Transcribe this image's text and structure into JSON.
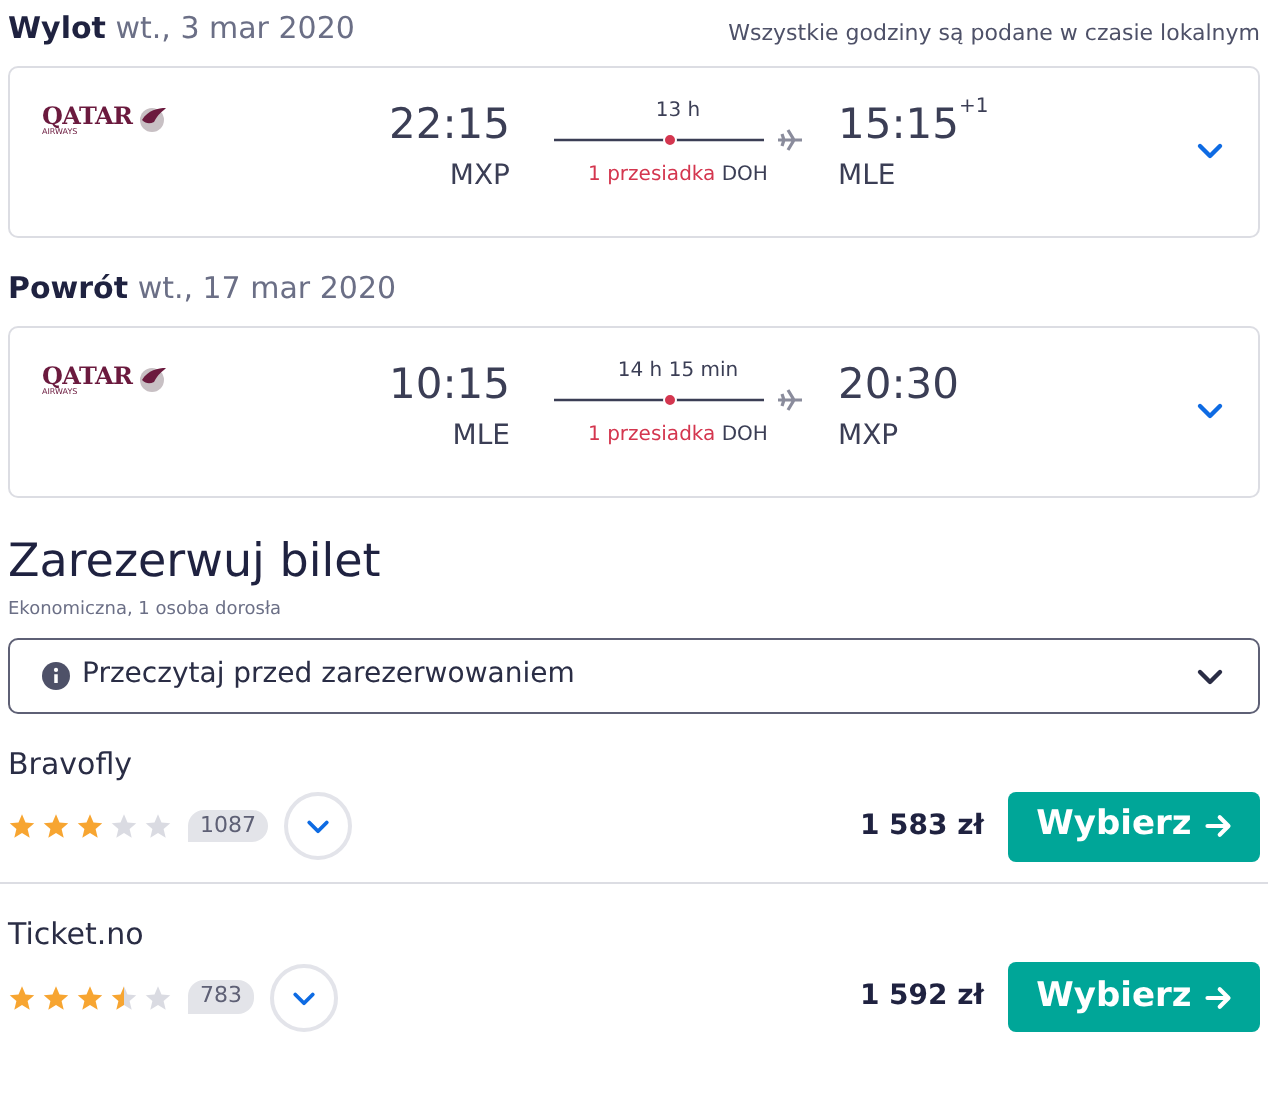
{
  "legs": [
    {
      "label": "Wylot",
      "date": "wt., 3 mar 2020",
      "note": "Wszystkie godziny są podane w czasie lokalnym",
      "airline": {
        "name": "QATAR",
        "sub": "AIRWAYS"
      },
      "depart_time": "22:15",
      "depart_airport": "MXP",
      "duration": "13 h",
      "stops": "1 przesiadka",
      "stop_airport": "DOH",
      "arrive_time": "15:15",
      "day_offset": "+1",
      "arrive_airport": "MLE"
    },
    {
      "label": "Powrót",
      "date": "wt., 17 mar 2020",
      "airline": {
        "name": "QATAR",
        "sub": "AIRWAYS"
      },
      "depart_time": "10:15",
      "depart_airport": "MLE",
      "duration": "14 h 15 min",
      "stops": "1 przesiadka",
      "stop_airport": "DOH",
      "arrive_time": "20:30",
      "arrive_airport": "MXP"
    }
  ],
  "booking": {
    "title": "Zarezerwuj bilet",
    "subtitle": "Ekonomiczna, 1 osoba dorosła",
    "notice": "Przeczytaj przed zarezerwowaniem",
    "offers": [
      {
        "name": "Bravofly",
        "stars": 3,
        "reviews": "1087",
        "price": "1 583 zł",
        "button": "Wybierz"
      },
      {
        "name": "Ticket.no",
        "stars": 3.5,
        "reviews": "783",
        "price": "1 592 zł",
        "button": "Wybierz"
      }
    ]
  }
}
